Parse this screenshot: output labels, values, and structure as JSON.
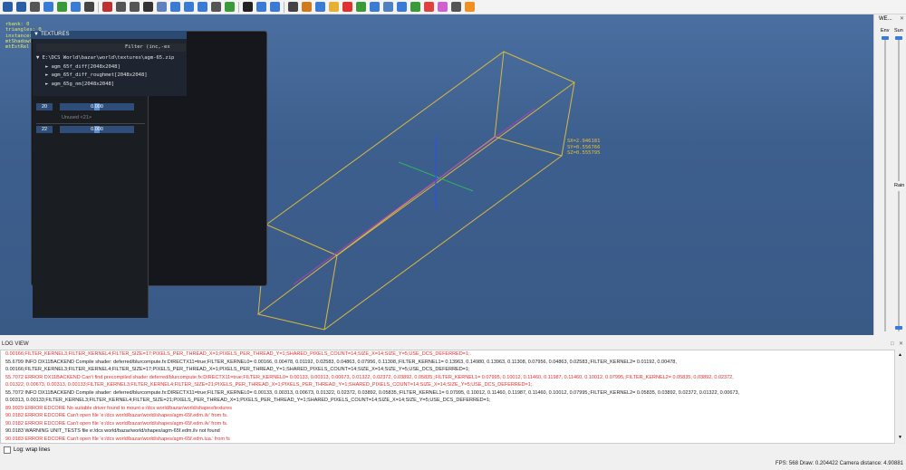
{
  "viewport": {
    "stats": [
      "rbank: 0",
      "triangles: 0",
      "instances: 0",
      "mtShadowCaster: 0",
      "mtEstRel: 0"
    ],
    "coords": [
      "SX=2.946181",
      "SY=0.556766",
      "SZ=0.555795"
    ]
  },
  "textures_panel": {
    "title": "TEXTURES",
    "filter_label": "Filter (inc,-ex",
    "root": "E:\\DCS World\\bazar\\world\\textures\\agm-65.zip",
    "items": [
      "agm_65f_diff[2048x2048]",
      "agm_65f_diff_roughmet[2048x2048]",
      "agm_65g_nm[2048x2048]"
    ],
    "rows": [
      {
        "index": "20",
        "value": "0.000"
      },
      {
        "index": "22",
        "value": "0.000"
      }
    ],
    "unused": "Unused <21>"
  },
  "weather": {
    "title": "WE...",
    "env_label": "Env",
    "sun_label": "Sun",
    "rain_label": "Rain"
  },
  "log": {
    "header": "LOG VIEW",
    "lines": [
      {
        "type": "err",
        "text": "0.00166;FILTER_KERNEL3;FILTER_KERNEL4;FILTER_SIZE=17;PIXELS_PER_THREAD_X=1;PIXELS_PER_THREAD_Y=1;SHARED_PIXELS_COUNT=14;SIZE_X=14;SIZE_Y=5;USE_DCS_DEFERRED=1;."
      },
      {
        "type": "info",
        "text": "55.6799 INFO DX11BACKEND Compile shader: deferred/blurcompute.fx:DIRECTX11=true;FILTER_KERNEL0= 0.00166, 0.00478, 0.01192, 0.02583, 0.04863, 0.07956, 0.11308,;FILTER_KERNEL1= 0.13963, 0.14980, 0.13963, 0.11308, 0.07956, 0.04863, 0.02583,;FILTER_KERNEL2= 0.01192, 0.00478,"
      },
      {
        "type": "info",
        "text": "0.00166;FILTER_KERNEL3;FILTER_KERNEL4;FILTER_SIZE=17;PIXELS_PER_THREAD_X=1;PIXELS_PER_THREAD_Y=1;SHARED_PIXELS_COUNT=14;SIZE_X=14;SIZE_Y=5;USE_DCS_DEFERRED=1;"
      },
      {
        "type": "err",
        "text": "55.7072 ERROR DX11BACKEND Can't find precompiled shader deferred/blurcompute.fx:DIRECTX11=true;FILTER_KERNEL0= 0.00133, 0.00313, 0.00673, 0.01322, 0.02372, 0.03892, 0.05835,;FILTER_KERNEL1= 0.07995, 0.10012, 0.11460, 0.11987, 0.11460, 0.10012, 0.07995,;FILTER_KERNEL2= 0.05835, 0.03892, 0.02372,"
      },
      {
        "type": "err",
        "text": "0.01322, 0.00673, 0.00313, 0.00133;FILTER_KERNEL3;FILTER_KERNEL4;FILTER_SIZE=21;PIXELS_PER_THREAD_X=1;PIXELS_PER_THREAD_Y=1;SHARED_PIXELS_COUNT=14;SIZE_X=14;SIZE_Y=5;USE_DCS_DEFERRED=1;."
      },
      {
        "type": "info",
        "text": "55.7072 INFO DX11BACKEND Compile shader: deferred/blurcompute.fx:DIRECTX11=true;FILTER_KERNEL0= 0.00133, 0.00313, 0.00673, 0.01322, 0.02372, 0.03892, 0.05835,;FILTER_KERNEL1= 0.07995, 0.10012, 0.11460, 0.11987, 0.11460, 0.10012, 0.07995,;FILTER_KERNEL2= 0.05835, 0.03892, 0.02372, 0.01322, 0.00673,"
      },
      {
        "type": "info",
        "text": "0.00313, 0.00133;FILTER_KERNEL3;FILTER_KERNEL4;FILTER_SIZE=21;PIXELS_PER_THREAD_X=1;PIXELS_PER_THREAD_Y=1;SHARED_PIXELS_COUNT=14;SIZE_X=14;SIZE_Y=5;USE_DCS_DEFERRED=1;"
      },
      {
        "type": "err",
        "text": "89.9929 ERROR EDCORE No suitable driver found to mount e:/dcs world/bazar/world/shapes/textures"
      },
      {
        "type": "err",
        "text": "90.0182 ERROR EDCORE Can't open file 'e:/dcs world/bazar/world/shapes/agm-65f.edm.ilv' from fs."
      },
      {
        "type": "err",
        "text": "90.0182 ERROR EDCORE Can't open file 'e:/dcs world/bazar/world/shapes/agm-65f.edm.ilv' from fs."
      },
      {
        "type": "warn",
        "text": "90.0183 WARNING UNIT_TESTS file e:/dcs world/bazar/world/shapes/agm-65f.edm.ilv not found"
      },
      {
        "type": "err",
        "text": "90.0183 ERROR EDCORE Can't open file 'e:/dcs world/bazar/world/shapes/agm-65f.edm.lua.' from fs"
      }
    ],
    "wrap_label": "Log: wrap lines"
  },
  "status": {
    "text": "FPS: 568  Draw: 0.204422  Camera distance: 4.90881"
  },
  "toolbar_icons": [
    {
      "name": "save-icon",
      "color": "#2b5ca8"
    },
    {
      "name": "open-icon",
      "color": "#2b5ca8"
    },
    {
      "name": "print-icon",
      "color": "#555555"
    },
    {
      "name": "circle-icon",
      "color": "#3a7bd5"
    },
    {
      "name": "reload-icon",
      "color": "#3a9a3a"
    },
    {
      "name": "refresh-icon",
      "color": "#3a7bd5"
    },
    {
      "name": "grid-icon",
      "color": "#444444"
    },
    {
      "name": "x-icon",
      "color": "#c03030"
    },
    {
      "name": "person-icon",
      "color": "#555555"
    },
    {
      "name": "play-icon",
      "color": "#555555"
    },
    {
      "name": "cross-icon",
      "color": "#333333"
    },
    {
      "name": "layers-icon",
      "color": "#6080c0"
    },
    {
      "name": "filter-icon",
      "color": "#3a7bd5"
    },
    {
      "name": "flask-icon",
      "color": "#3a7bd5"
    },
    {
      "name": "lamp-icon",
      "color": "#3a7bd5"
    },
    {
      "name": "film-icon",
      "color": "#555555"
    },
    {
      "name": "palette-icon",
      "color": "#3a9a3a"
    },
    {
      "name": "square-icon",
      "color": "#222222"
    },
    {
      "name": "rotate-icon",
      "color": "#3a7bd5"
    },
    {
      "name": "gear-icon",
      "color": "#3a7bd5"
    },
    {
      "name": "monitor-icon",
      "color": "#444444"
    },
    {
      "name": "chart-icon",
      "color": "#d07a20"
    },
    {
      "name": "drop-icon",
      "color": "#3a7bd5"
    },
    {
      "name": "sun-icon",
      "color": "#e8b030"
    },
    {
      "name": "red-square-icon",
      "color": "#e03030"
    },
    {
      "name": "mesh-icon",
      "color": "#3a9a3a"
    },
    {
      "name": "asterisk-icon",
      "color": "#3a7bd5"
    },
    {
      "name": "sphere-icon",
      "color": "#5080c0"
    },
    {
      "name": "blocks-icon",
      "color": "#3a7bd5"
    },
    {
      "name": "photo-icon",
      "color": "#3a9a3a"
    },
    {
      "name": "cancel-icon",
      "color": "#e04040"
    },
    {
      "name": "pink-icon",
      "color": "#d060d0"
    },
    {
      "name": "window-icon",
      "color": "#555555"
    },
    {
      "name": "orange-icon",
      "color": "#f09020"
    }
  ]
}
